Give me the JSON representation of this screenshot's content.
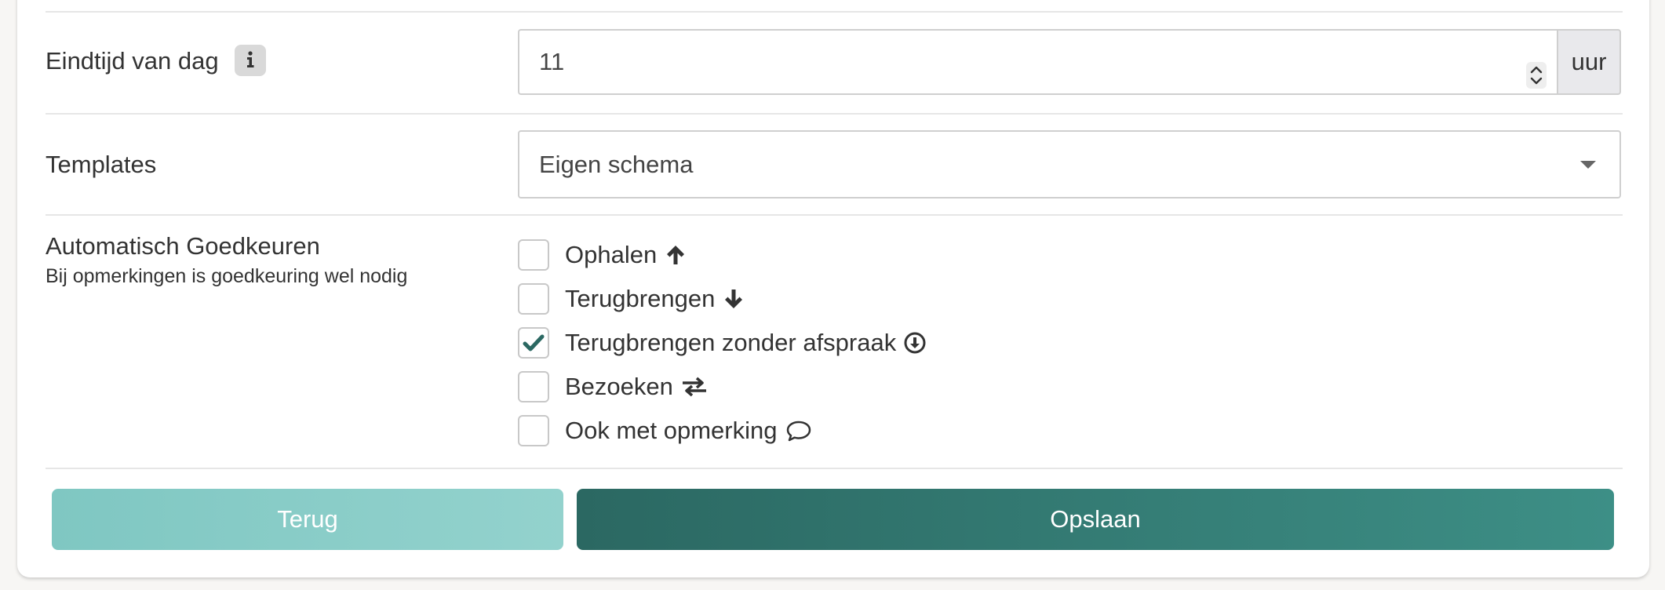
{
  "form": {
    "end_time": {
      "label": "Eindtijd van dag",
      "info_icon": "info-icon",
      "value": "11",
      "unit": "uur"
    },
    "templates": {
      "label": "Templates",
      "selected": "Eigen schema"
    },
    "auto_approve": {
      "label": "Automatisch Goedkeuren",
      "sublabel": "Bij opmerkingen is goedkeuring wel nodig",
      "options": [
        {
          "label": "Ophalen",
          "icon": "arrow-up-icon",
          "checked": false
        },
        {
          "label": "Terugbrengen",
          "icon": "arrow-down-icon",
          "checked": false
        },
        {
          "label": "Terugbrengen zonder afspraak",
          "icon": "circle-arrow-down-icon",
          "checked": true
        },
        {
          "label": "Bezoeken",
          "icon": "exchange-icon",
          "checked": false
        },
        {
          "label": "Ook met opmerking",
          "icon": "comment-icon",
          "checked": false
        }
      ]
    }
  },
  "buttons": {
    "back": "Terug",
    "save": "Opslaan"
  },
  "colors": {
    "primary": "#2f7a72",
    "secondary": "#8ccfca",
    "check": "#2b6862"
  }
}
